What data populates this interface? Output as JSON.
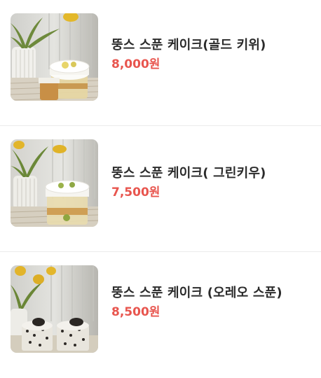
{
  "products": [
    {
      "name": "뚱스 스푼 케이크(골드 키위)",
      "price": "8,000원",
      "image": "gold-kiwi-spoon-cake-photo"
    },
    {
      "name": "뚱스 스푼 케이크( 그린키우)",
      "price": "7,500원",
      "image": "green-kiwi-spoon-cake-photo"
    },
    {
      "name": "뚱스 스푼 케이크 (오레오 스푼)",
      "price": "8,500원",
      "image": "oreo-spoon-cake-photo"
    }
  ],
  "colors": {
    "price": "#e8554e",
    "name": "#2b2b2b",
    "divider": "#ececec"
  }
}
